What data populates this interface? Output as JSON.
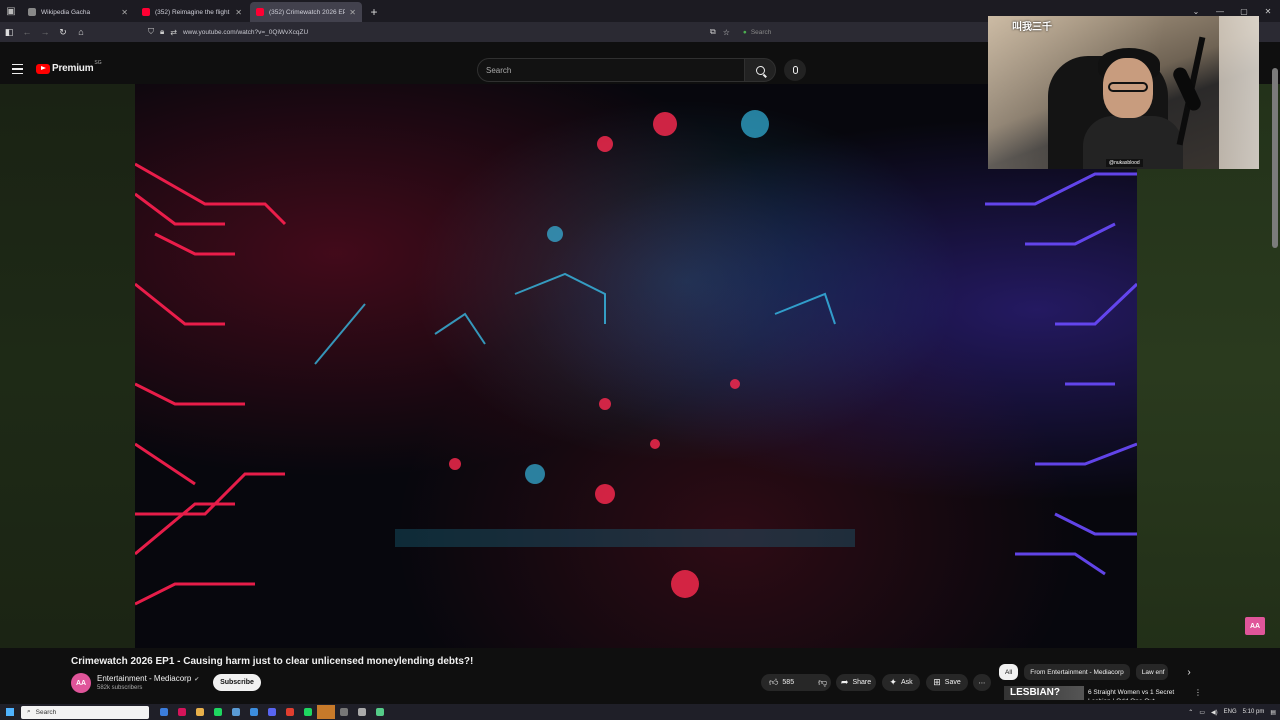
{
  "browser": {
    "tabs": [
      {
        "title": "Wikipedia Gacha",
        "favicon_color": "#888888",
        "active": false
      },
      {
        "title": "(352) Reimagine the flight a",
        "favicon_color": "#ff0033",
        "active": false
      },
      {
        "title": "(352) Crimewatch 2026 EP1",
        "favicon_color": "#ff0033",
        "active": true
      }
    ],
    "new_tab": "+",
    "url": "www.youtube.com/watch?v=_0QiWvXcqZU",
    "search_placeholder": "Search"
  },
  "youtube": {
    "logo_text": "Premium",
    "logo_badge": "SG",
    "search_placeholder": "Search",
    "video": {
      "title": "Crimewatch 2026 EP1 - Causing harm just to clear unlicensed moneylending debts?!"
    },
    "channel": {
      "name": "Entertainment - Mediacorp",
      "verified": "✔",
      "avatar_text": "AA",
      "subscribers": "582k subscribers",
      "subscribe_label": "Subscribe"
    },
    "actions": {
      "likes": "585",
      "share": "Share",
      "ask": "Ask",
      "save": "Save",
      "more": "⋯"
    },
    "chips": [
      "All",
      "From Entertainment - Mediacorp",
      "Law enf"
    ],
    "recommendation": {
      "thumb_text": "LESBIAN?",
      "title": "6 Straight Women vs 1 Secret Lesbian | Odd One Out"
    },
    "corner_badge": "AA"
  },
  "webcam": {
    "logo_text": "叫我三千",
    "handle": "@nukasblood"
  },
  "taskbar": {
    "search_label": "Search",
    "language": "ENG",
    "time": "5:10 pm",
    "apps": [
      "#3b7ddd",
      "#d4145a",
      "#e8b04b",
      "#1ed760",
      "#5a9bd5",
      "#3c8dde",
      "#5865f2",
      "#e03e2f",
      "#1ed760",
      "#c77a2a",
      "#777777",
      "#aaaaaa",
      "#55cc88"
    ]
  }
}
